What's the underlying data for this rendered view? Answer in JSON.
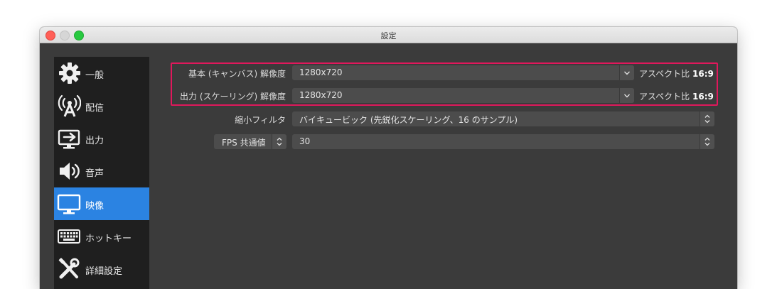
{
  "window": {
    "title": "設定"
  },
  "sidebar": {
    "items": [
      {
        "label": "一般",
        "icon": "gear-icon"
      },
      {
        "label": "配信",
        "icon": "broadcast-antenna-icon"
      },
      {
        "label": "出力",
        "icon": "output-monitor-icon"
      },
      {
        "label": "音声",
        "icon": "speaker-icon"
      },
      {
        "label": "映像",
        "icon": "monitor-icon",
        "active": true
      },
      {
        "label": "ホットキー",
        "icon": "keyboard-icon"
      },
      {
        "label": "詳細設定",
        "icon": "tools-icon"
      }
    ]
  },
  "video": {
    "base_resolution": {
      "label": "基本 (キャンバス) 解像度",
      "value": "1280x720",
      "aspect_prefix": "アスペクト比",
      "aspect": "16:9"
    },
    "output_resolution": {
      "label": "出力 (スケーリング) 解像度",
      "value": "1280x720",
      "aspect_prefix": "アスペクト比",
      "aspect": "16:9"
    },
    "downscale_filter": {
      "label": "縮小フィルタ",
      "value": "バイキュービック (先鋭化スケーリング、16 のサンプル)"
    },
    "fps": {
      "type_label": "FPS 共通値",
      "value": "30"
    }
  },
  "colors": {
    "accent": "#2b83e2",
    "highlight": "#e0185c",
    "panel": "#3b3b3b",
    "sidebar": "#1f1f1f"
  }
}
